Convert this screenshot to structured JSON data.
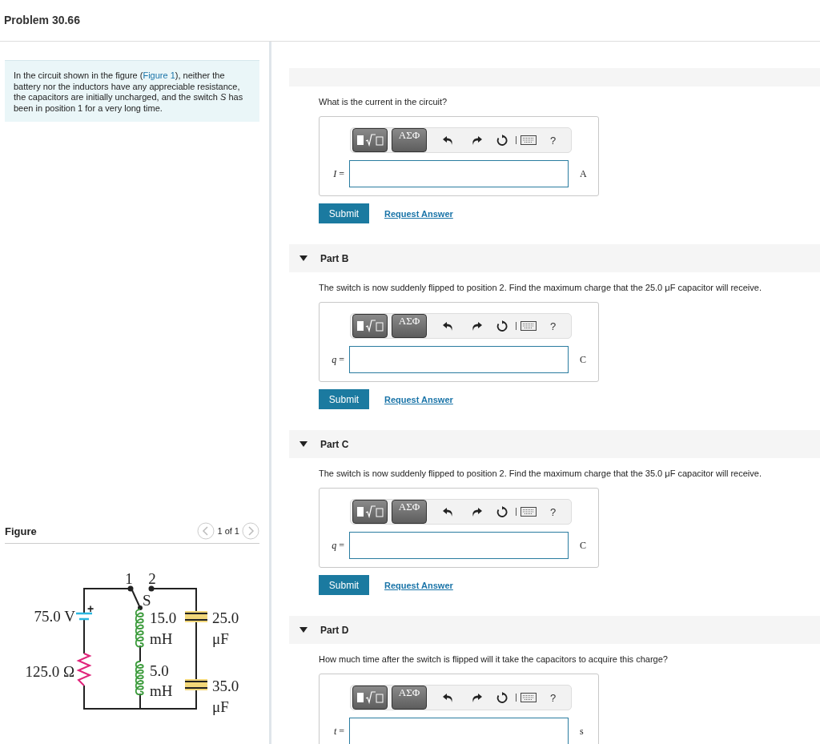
{
  "header": {
    "title": "Problem 30.66"
  },
  "intro": {
    "before": "In the circuit shown in the figure (",
    "link": "Figure 1",
    "after": "), neither the battery nor the inductors have any appreciable resistance, the capacitors are initially uncharged, and the switch *S* has been in position 1 for a very long time."
  },
  "figure": {
    "title": "Figure",
    "pager": "1 of 1",
    "circuit": {
      "switch_positions": [
        "1",
        "2"
      ],
      "switch_label": "S",
      "battery": {
        "voltage": "75.0 V",
        "polarity": "+"
      },
      "resistor": "125.0 Ω",
      "inductors": [
        {
          "value": "15.0",
          "unit": "mH"
        },
        {
          "value": "5.0",
          "unit": "mH"
        }
      ],
      "capacitors": [
        {
          "value": "25.0",
          "unit": "μF"
        },
        {
          "value": "35.0",
          "unit": "μF"
        }
      ]
    }
  },
  "parts": [
    {
      "question": "What is the current in the circuit?",
      "symbols": "ΑΣΦ",
      "help": "?",
      "variable": "*I* =",
      "unit": "A",
      "submit": "Submit",
      "request": "Request Answer"
    },
    {
      "title": "Part B",
      "expanded": true,
      "question": "The switch is now suddenly flipped to position 2. Find the maximum charge that the 25.0 μF capacitor will receive.",
      "symbols": "ΑΣΦ",
      "help": "?",
      "variable": "*q* =",
      "unit": "C",
      "submit": "Submit",
      "request": "Request Answer"
    },
    {
      "title": "Part C",
      "expanded": true,
      "question": "The switch is now suddenly flipped to position 2. Find the maximum charge that the 35.0 μF capacitor will receive.",
      "symbols": "ΑΣΦ",
      "help": "?",
      "variable": "*q* =",
      "unit": "C",
      "submit": "Submit",
      "request": "Request Answer"
    },
    {
      "title": "Part D",
      "expanded": true,
      "question": "How much time after the switch is flipped will it take the capacitors to acquire this charge?",
      "symbols": "ΑΣΦ",
      "help": "?",
      "variable": "*t* =",
      "unit": "s"
    }
  ]
}
